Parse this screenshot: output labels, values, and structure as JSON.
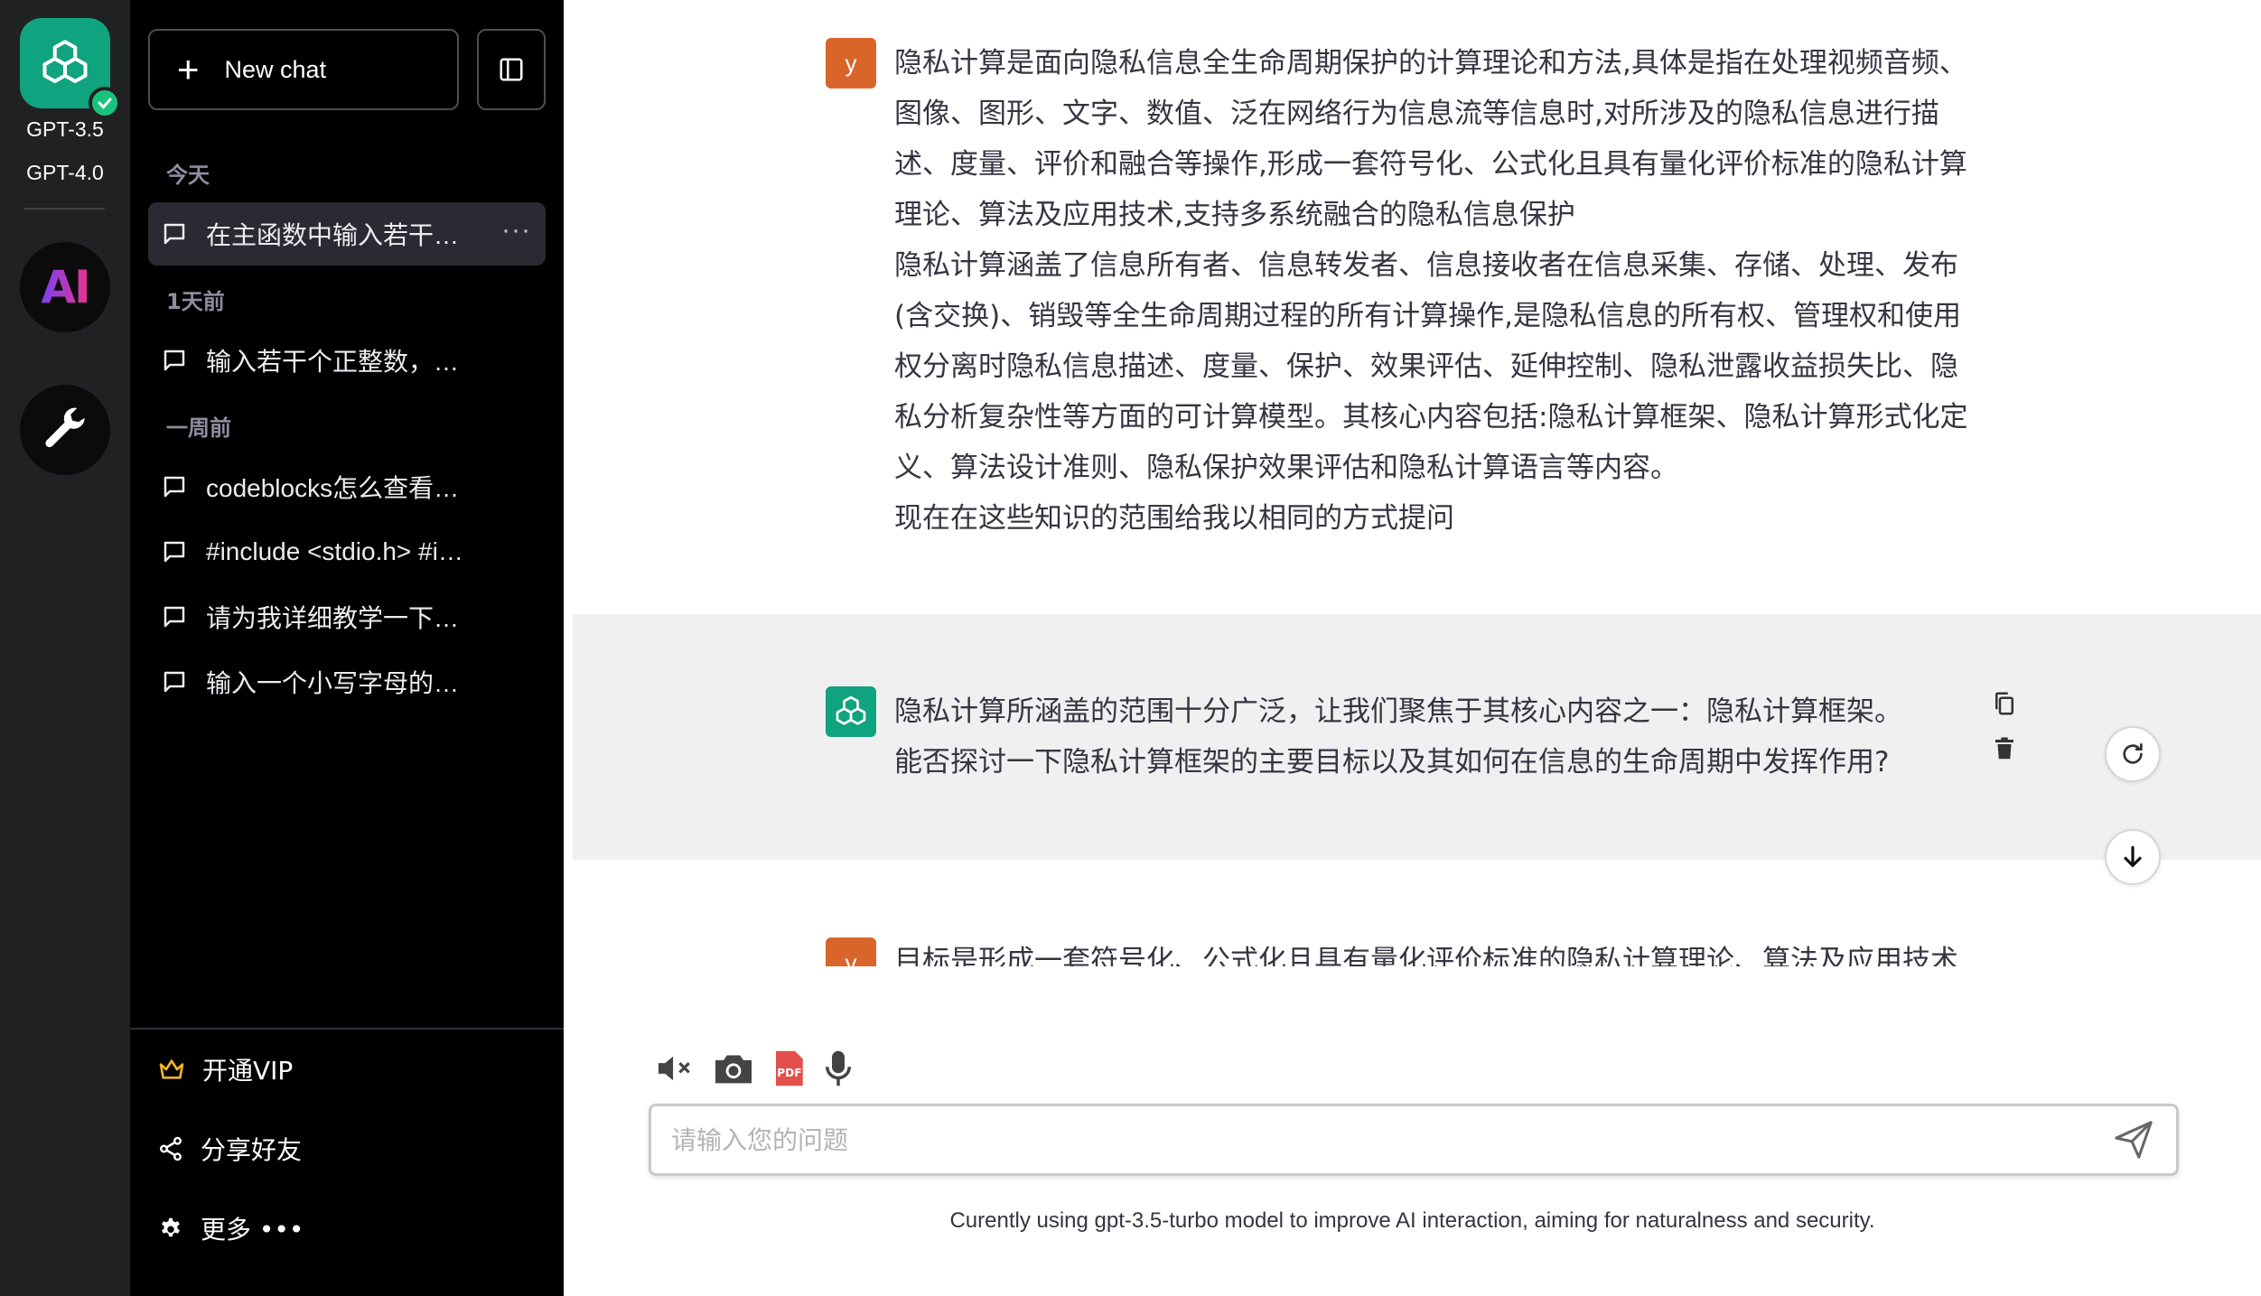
{
  "rail": {
    "models": [
      "GPT-3.5",
      "GPT-4.0"
    ],
    "ai_label": "AI"
  },
  "sidebar": {
    "new_chat_label": "New chat",
    "groups": [
      {
        "label": "今天",
        "items": [
          {
            "label": "在主函数中输入若干…",
            "active": true
          }
        ]
      },
      {
        "label": "1天前",
        "items": [
          {
            "label": "输入若干个正整数，…"
          }
        ]
      },
      {
        "label": "一周前",
        "items": [
          {
            "label": "codeblocks怎么查看…"
          },
          {
            "label": "#include <stdio.h> #i…"
          },
          {
            "label": "请为我详细教学一下…"
          },
          {
            "label": "输入一个小写字母的…"
          }
        ]
      }
    ],
    "more_dots": "···",
    "bottom": {
      "vip": "开通VIP",
      "share": "分享好友",
      "more": "更多 •••"
    }
  },
  "conversation": {
    "user_avatar": "y",
    "user_message": [
      "隐私计算是面向隐私信息全生命周期保护的计算理论和方法,具体是指在处理视频音频、",
      "图像、图形、文字、数值、泛在网络行为信息流等信息时,对所涉及的隐私信息进行描",
      "述、度量、评价和融合等操作,形成一套符号化、公式化且具有量化评价标准的隐私计算",
      "理论、算法及应用技术,支持多系统融合的隐私信息保护",
      "隐私计算涵盖了信息所有者、信息转发者、信息接收者在信息采集、存储、处理、发布",
      "(含交换)、销毁等全生命周期过程的所有计算操作,是隐私信息的所有权、管理权和使用",
      "权分离时隐私信息描述、度量、保护、效果评估、延伸控制、隐私泄露收益损失比、隐",
      "私分析复杂性等方面的可计算模型。其核心内容包括:隐私计算框架、隐私计算形式化定",
      "义、算法设计准则、隐私保护效果评估和隐私计算语言等内容。",
      "现在在这些知识的范围给我以相同的方式提问"
    ],
    "ai_message": [
      "隐私计算所涵盖的范围十分广泛，让我们聚焦于其核心内容之一：隐私计算框架。",
      "能否探讨一下隐私计算框架的主要目标以及其如何在信息的生命周期中发挥作用?"
    ],
    "next_user_preview": "目标是形成一套符号化、公式化且具有量化评价标准的隐私计算理论、算法及应用技术"
  },
  "composer": {
    "placeholder": "请输入您的问题",
    "value": "",
    "tools": [
      "speaker-muted-icon",
      "camera-icon",
      "pdf-icon",
      "microphone-icon"
    ],
    "pdf_label": "PDF",
    "footer_note": "Curently using gpt-3.5-turbo model to improve AI interaction, aiming for naturalness and security."
  },
  "colors": {
    "brand": "#10a37f",
    "user_avatar": "#d9652b",
    "sidebar_bg": "#000000",
    "rail_bg": "#202123",
    "ai_row_bg": "#f0f0f0"
  }
}
